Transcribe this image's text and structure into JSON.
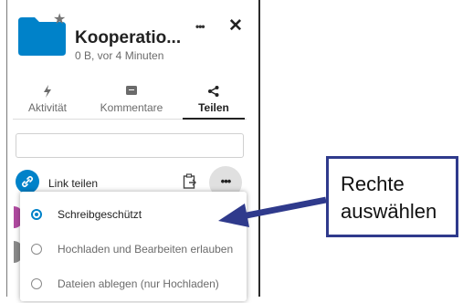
{
  "file": {
    "title": "Kooperatio...",
    "subtitle": "0 B, vor 4 Minuten",
    "folder_color": "#0082c9"
  },
  "header_actions": {
    "menu_icon": "•••",
    "close_icon": "✕",
    "star_icon": "★"
  },
  "tabs": [
    {
      "icon": "ϟ",
      "label": "Aktivität"
    },
    {
      "icon": "▣",
      "label": "Kommentare"
    },
    {
      "icon": "<",
      "label": "Teilen",
      "active": true
    }
  ],
  "search": {
    "value": "",
    "placeholder": ""
  },
  "link_share": {
    "label": "Link teilen",
    "more_icon": "•••"
  },
  "permissions": [
    {
      "label": "Schreibgeschützt",
      "checked": true
    },
    {
      "label": "Hochladen und Bearbeiten erlauben",
      "checked": false
    },
    {
      "label": "Dateien ablegen (nur Hochladen)",
      "checked": false
    }
  ],
  "callout": {
    "line1": "Rechte",
    "line2": "auswählen",
    "color": "#2f3a8c"
  }
}
